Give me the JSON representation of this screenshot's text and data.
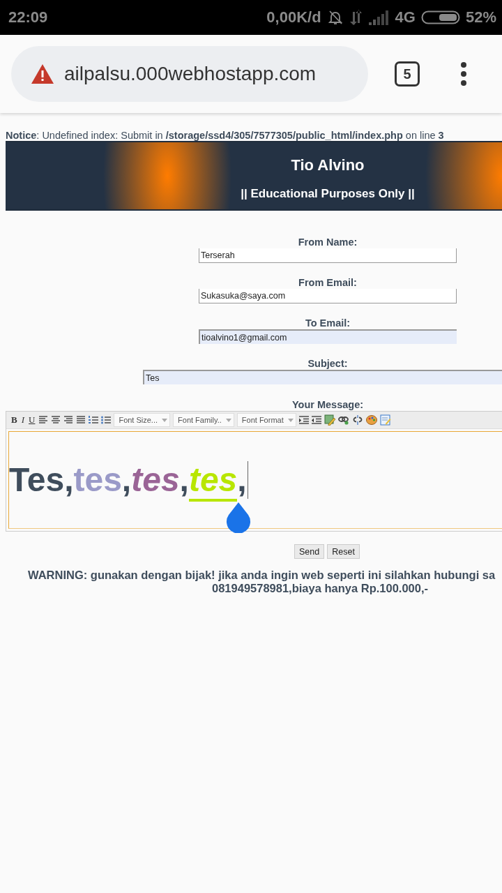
{
  "status_bar": {
    "time": "22:09",
    "speed": "0,00K/d",
    "network": "4G",
    "battery": "52%"
  },
  "browser": {
    "url": "ailpalsu.000webhostapp.com",
    "tab_count": "5"
  },
  "notice": "**Notice**: Undefined index: Submit in **/storage/ssd4/305/7577305/public_html/index.php** on line **3**",
  "banner": {
    "title": "Tio Alvino",
    "subtitle": "|| Educational Purposes Only ||"
  },
  "fields": [
    {
      "label": "From Name:",
      "value": "Terserah",
      "autofilled": false,
      "wide": false
    },
    {
      "label": "From Email:",
      "value": "Sukasuka@saya.com",
      "autofilled": false,
      "wide": false
    },
    {
      "label": "To Email:",
      "value": "tioalvino1@gmail.com",
      "autofilled": true,
      "wide": false
    },
    {
      "label": "Subject:",
      "value": "Tes",
      "autofilled": true,
      "wide": true
    }
  ],
  "message": {
    "label": "Your Message:",
    "toolbar": [
      {
        "kind": "bold",
        "label": "B"
      },
      {
        "kind": "italic",
        "label": "I"
      },
      {
        "kind": "underline",
        "label": "U"
      },
      {
        "kind": "align-left"
      },
      {
        "kind": "align-center"
      },
      {
        "kind": "align-right"
      },
      {
        "kind": "justify"
      },
      {
        "kind": "numbered-list"
      },
      {
        "kind": "bullet-list"
      },
      {
        "kind": "select",
        "label": "Font Size..."
      },
      {
        "kind": "select",
        "label": "Font Family.."
      },
      {
        "kind": "select",
        "label": "Font Format"
      },
      {
        "kind": "indent"
      },
      {
        "kind": "outdent"
      },
      {
        "kind": "image"
      },
      {
        "kind": "link"
      },
      {
        "kind": "unlink"
      },
      {
        "kind": "palette"
      },
      {
        "kind": "source"
      }
    ],
    "content": [
      {
        "text": "Tes,",
        "color": "#3f4d5c",
        "italic": false,
        "underline": false
      },
      {
        "text": "tes",
        "color": "#9a9ac8",
        "italic": false,
        "underline": false
      },
      {
        "text": ",",
        "color": "#3f4d5c",
        "italic": false,
        "underline": false
      },
      {
        "text": "tes",
        "color": "#9a6496",
        "italic": true,
        "underline": false
      },
      {
        "text": ",",
        "color": "#3f4d5c",
        "italic": false,
        "underline": false
      },
      {
        "text": "tes",
        "color": "#b8e600",
        "italic": true,
        "underline": true
      },
      {
        "text": ",",
        "color": "#3f4d5c",
        "italic": false,
        "underline": false
      }
    ]
  },
  "buttons": [
    "Send",
    "Reset"
  ],
  "warning": [
    "WARNING: gunakan dengan bijak! jika anda ingin web seperti ini silahkan hubungi sa",
    "081949578981,biaya hanya Rp.100.000,-"
  ]
}
